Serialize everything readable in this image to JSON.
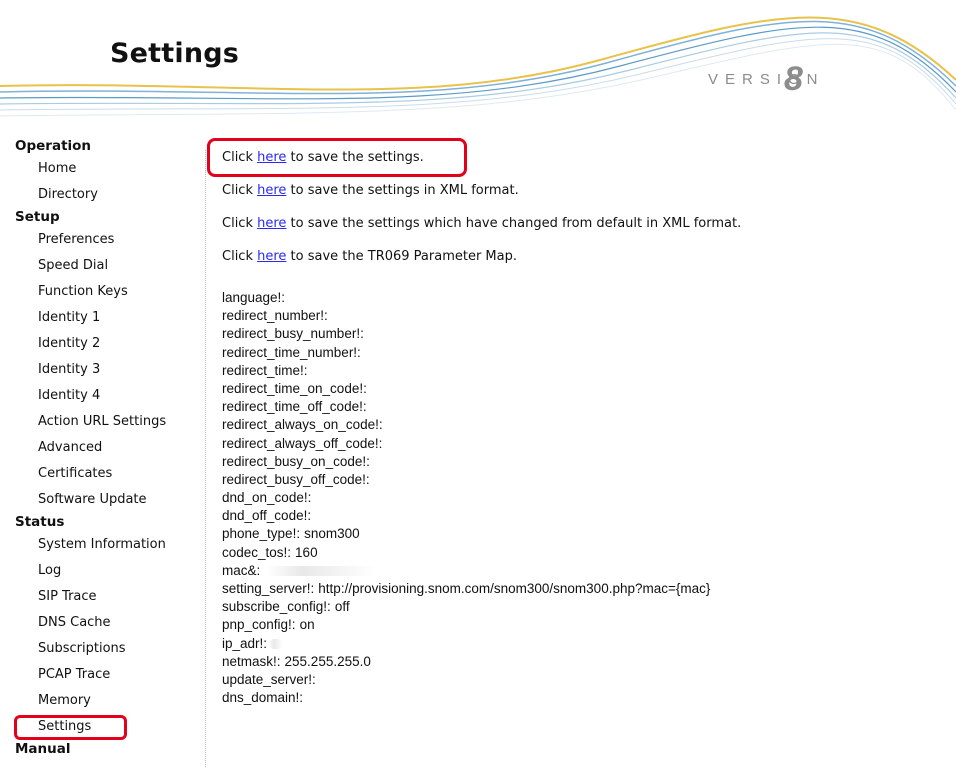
{
  "header": {
    "title": "Settings",
    "version_label": "VERSION",
    "version_number": "8"
  },
  "sidebar": {
    "groups": [
      {
        "label": "Operation",
        "items": [
          "Home",
          "Directory"
        ]
      },
      {
        "label": "Setup",
        "items": [
          "Preferences",
          "Speed Dial",
          "Function Keys",
          "Identity 1",
          "Identity 2",
          "Identity 3",
          "Identity 4",
          "Action URL Settings",
          "Advanced",
          "Certificates",
          "Software Update"
        ]
      },
      {
        "label": "Status",
        "items": [
          "System Information",
          "Log",
          "SIP Trace",
          "DNS Cache",
          "Subscriptions",
          "PCAP Trace",
          "Memory",
          "Settings"
        ]
      },
      {
        "label": "Manual",
        "items": []
      }
    ],
    "active_item": "Settings"
  },
  "content": {
    "save_links": [
      {
        "prefix": "Click ",
        "link": "here",
        "suffix": " to save the settings."
      },
      {
        "prefix": "Click ",
        "link": "here",
        "suffix": " to save the settings in XML format."
      },
      {
        "prefix": "Click ",
        "link": "here",
        "suffix": " to save the settings which have changed from default in XML format."
      },
      {
        "prefix": "Click ",
        "link": "here",
        "suffix": " to save the TR069 Parameter Map."
      }
    ],
    "settings": [
      {
        "key": "language!:",
        "value": ""
      },
      {
        "key": "redirect_number!:",
        "value": ""
      },
      {
        "key": "redirect_busy_number!:",
        "value": ""
      },
      {
        "key": "redirect_time_number!:",
        "value": ""
      },
      {
        "key": "redirect_time!:",
        "value": ""
      },
      {
        "key": "redirect_time_on_code!:",
        "value": ""
      },
      {
        "key": "redirect_time_off_code!:",
        "value": ""
      },
      {
        "key": "redirect_always_on_code!:",
        "value": ""
      },
      {
        "key": "redirect_always_off_code!:",
        "value": ""
      },
      {
        "key": "redirect_busy_on_code!:",
        "value": ""
      },
      {
        "key": "redirect_busy_off_code!:",
        "value": ""
      },
      {
        "key": "dnd_on_code!:",
        "value": ""
      },
      {
        "key": "dnd_off_code!:",
        "value": ""
      },
      {
        "key": "phone_type!:",
        "value": "snom300"
      },
      {
        "key": "codec_tos!:",
        "value": "160"
      },
      {
        "key": "mac&:",
        "value": "",
        "redacted": true
      },
      {
        "key": "setting_server!:",
        "value": "http://provisioning.snom.com/snom300/snom300.php?mac={mac}"
      },
      {
        "key": "subscribe_config!:",
        "value": "off"
      },
      {
        "key": "pnp_config!:",
        "value": "on"
      },
      {
        "key": "ip_adr!:",
        "value": "",
        "redacted_short": true
      },
      {
        "key": "netmask!:",
        "value": "255.255.255.0"
      },
      {
        "key": "update_server!:",
        "value": ""
      },
      {
        "key": "dns_domain!:",
        "value": ""
      }
    ]
  },
  "colors": {
    "highlight": "#e2001a",
    "link": "#2a2af0",
    "version_gray": "#8c8c8c"
  }
}
